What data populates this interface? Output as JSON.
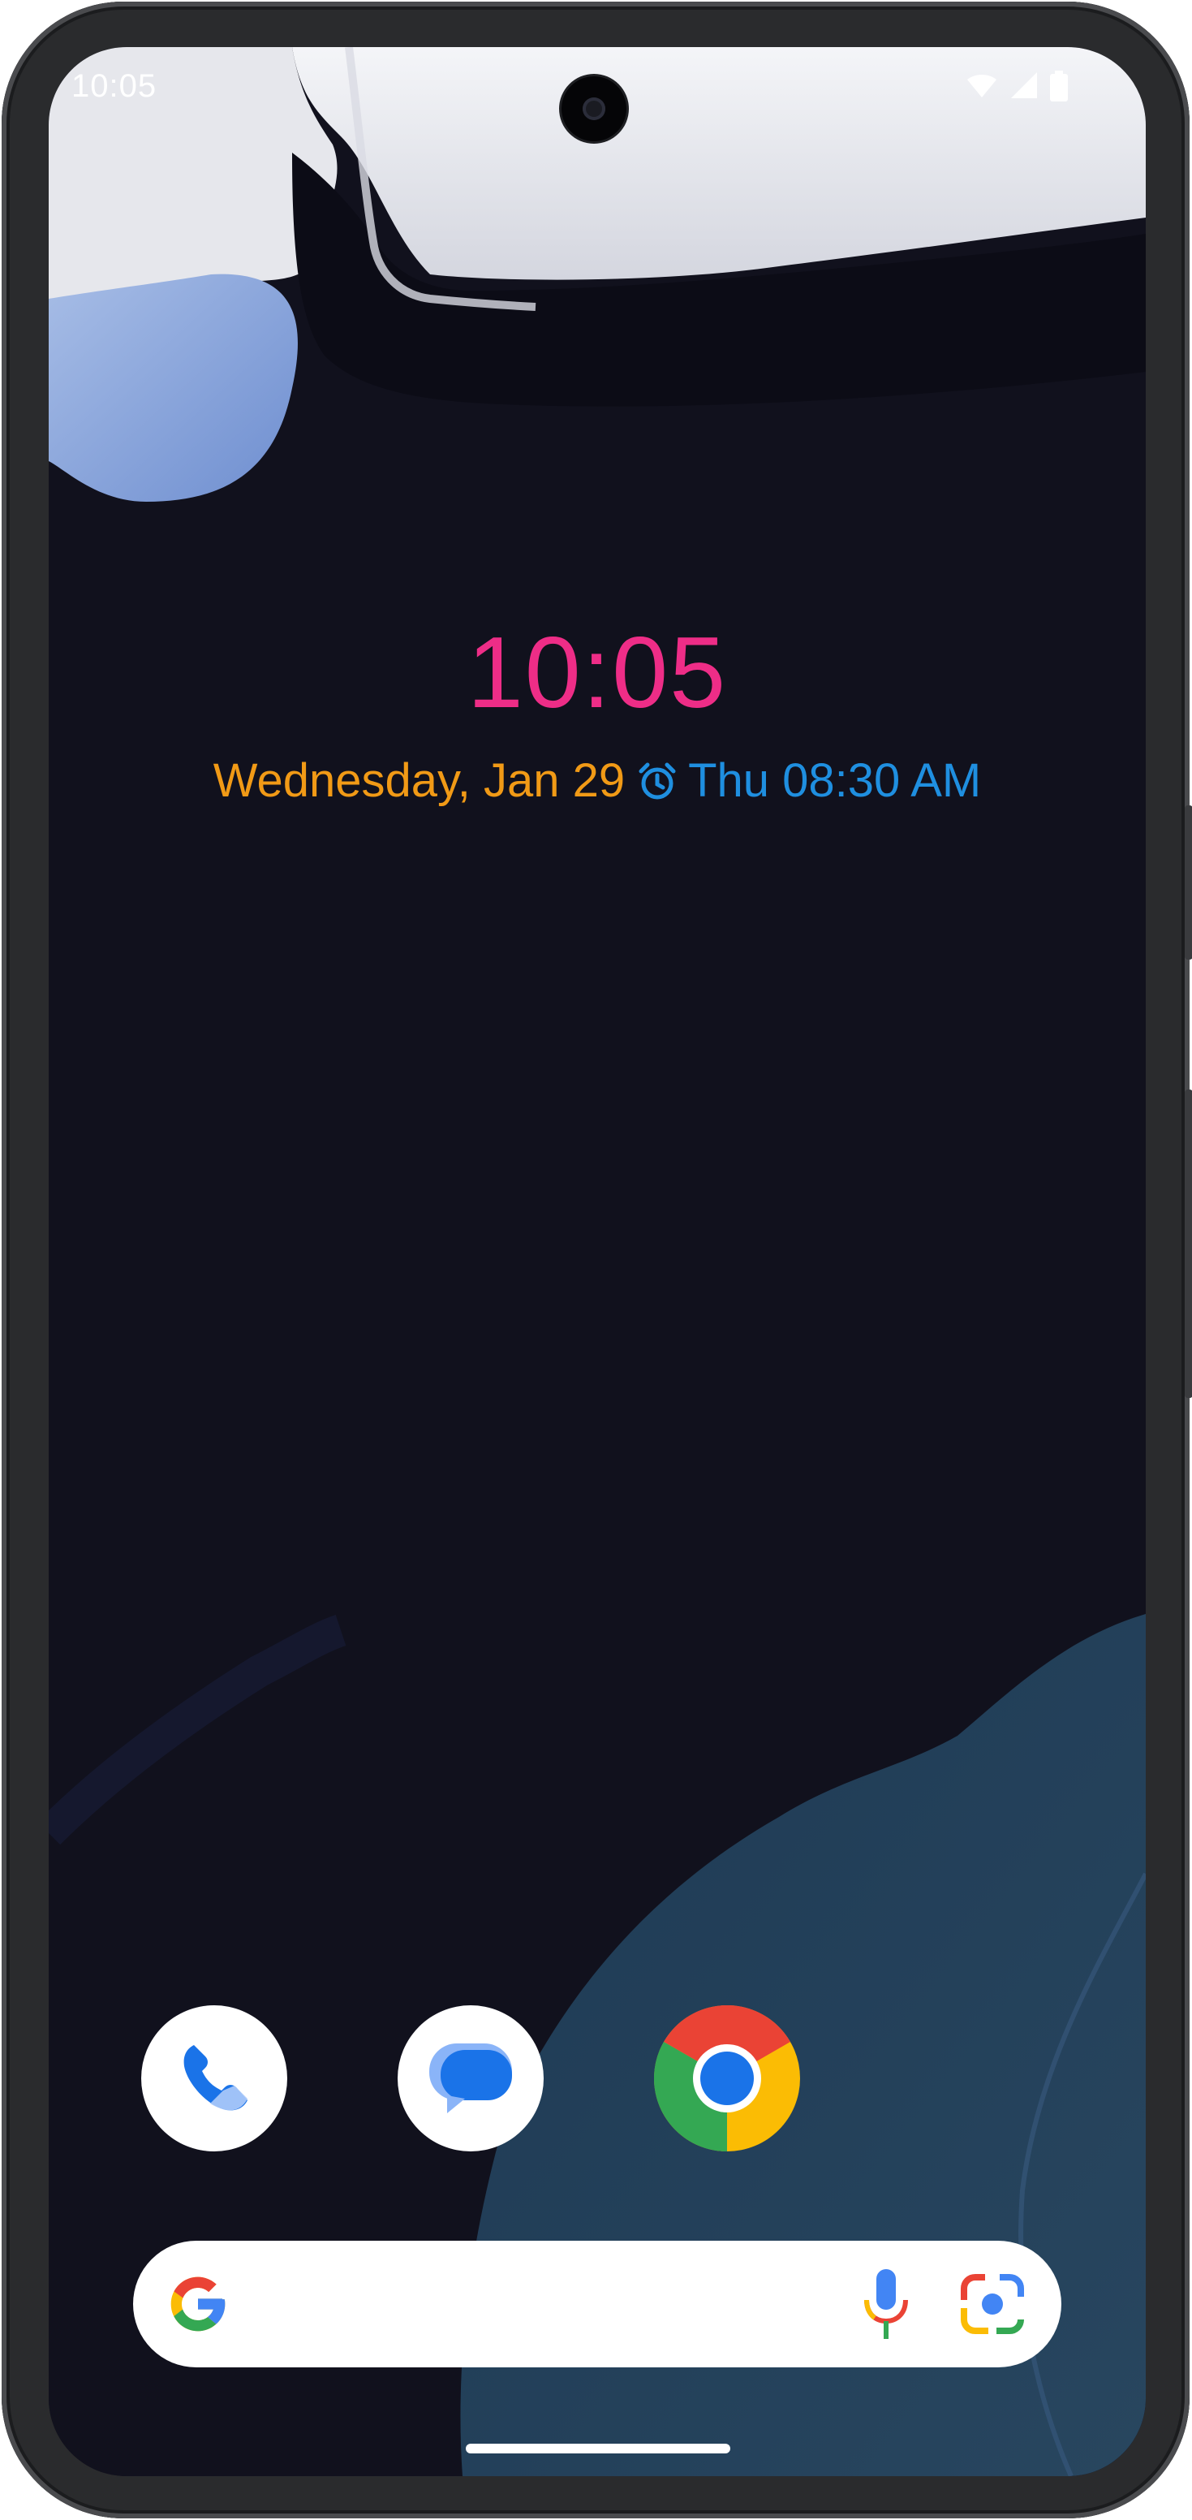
{
  "status_bar": {
    "time": "10:05",
    "wifi_icon": "wifi-icon",
    "signal_icon": "cell-signal-icon",
    "battery_icon": "battery-icon"
  },
  "lock_clock": {
    "time": "10:05",
    "date": "Wednesday, Jan 29",
    "alarm_icon": "alarm-clock-icon",
    "alarm_text": "Thu 08:30 AM",
    "colors": {
      "time": "#ee2d87",
      "date": "#f19a16",
      "alarm": "#1f8fe0"
    }
  },
  "dock": {
    "apps": [
      {
        "name": "Phone",
        "icon": "phone-app-icon"
      },
      {
        "name": "Messages",
        "icon": "messages-app-icon"
      },
      {
        "name": "Chrome",
        "icon": "chrome-app-icon"
      }
    ]
  },
  "search_bar": {
    "google_icon": "google-g-icon",
    "mic_icon": "microphone-icon",
    "lens_icon": "google-lens-icon"
  }
}
